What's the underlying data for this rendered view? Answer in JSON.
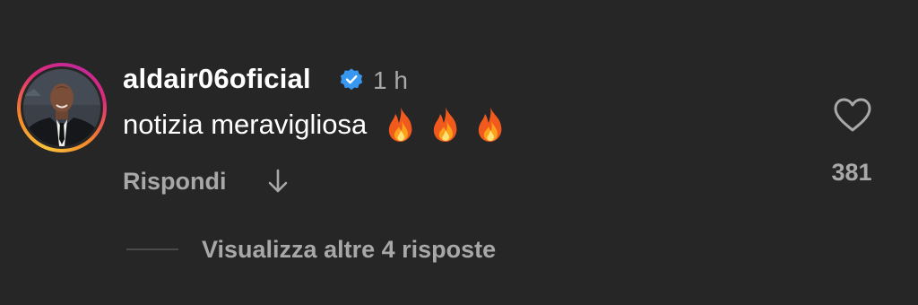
{
  "comment": {
    "username": "aldair06oficial",
    "verified_icon": "verified-badge-icon",
    "time": "1 h",
    "text": "notizia meravigliosa",
    "emojis": [
      "🔥",
      "🔥",
      "🔥"
    ],
    "reply_label": "Rispondi",
    "translate_icon": "arrow-down-icon",
    "like_icon": "heart-outline-icon",
    "like_count": "381",
    "view_more_label": "Visualizza altre 4 risposte"
  },
  "colors": {
    "background": "#262626",
    "primary_text": "#ffffff",
    "secondary_text": "#a8a8a8",
    "verified": "#3897f0",
    "divider": "#4a4a4a"
  }
}
